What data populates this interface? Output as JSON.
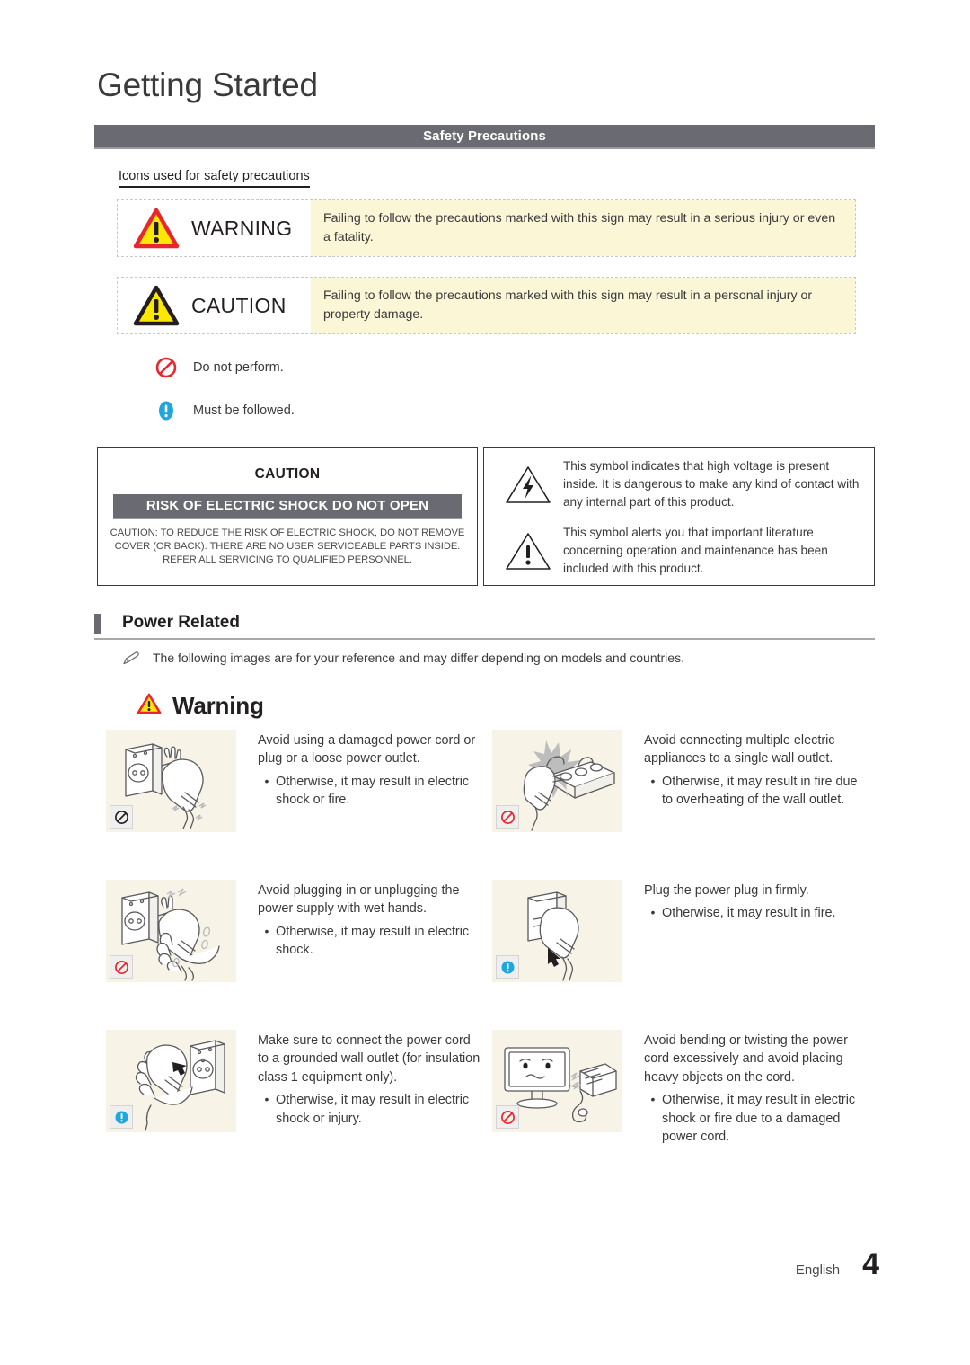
{
  "document": {
    "chapter_title": "Getting Started",
    "section_bar_label": "Safety Precautions",
    "sub_heading": "Icons used for safety precautions"
  },
  "definitions": [
    {
      "icon": "warning-triangle-red-icon",
      "word": "WARNING",
      "text": "Failing to follow the precautions marked with this sign may result in a serious injury or even a fatality."
    },
    {
      "icon": "caution-triangle-black-icon",
      "word": "CAUTION",
      "text": "Failing to follow the precautions marked with this sign may result in a personal injury or property damage."
    }
  ],
  "legend": [
    {
      "icon": "prohibited-circle-icon",
      "label": "Do not perform."
    },
    {
      "icon": "mandatory-exclamation-icon",
      "label": "Must be followed."
    }
  ],
  "shock_box": {
    "caution_title": "CAUTION",
    "bar_label": "RISK OF ELECTRIC SHOCK DO NOT OPEN",
    "body_line_1": "CAUTION: TO REDUCE THE RISK OF ELECTRIC SHOCK, DO NOT REMOVE",
    "body_line_2": "COVER (OR BACK). THERE ARE NO USER SERVICEABLE PARTS INSIDE.",
    "body_line_3": "REFER ALL SERVICING TO QUALIFIED PERSONNEL."
  },
  "symbol_box": {
    "rows": [
      {
        "icon": "high-voltage-lightning-triangle-icon",
        "text": "This symbol indicates that high voltage is present inside. It is dangerous to make any kind of contact with any internal part of this product."
      },
      {
        "icon": "attention-exclamation-triangle-icon",
        "text": "This symbol alerts you that important literature concerning operation and maintenance has been included with this product."
      }
    ]
  },
  "topic": {
    "title": "Power Related",
    "note_icon": "pencil-note-icon",
    "note": "The following images are for your reference and may differ depending on models and countries.",
    "warning_heading_icon": "warning-triangle-small-icon",
    "warning_heading": "Warning"
  },
  "precautions": [
    {
      "illustration": "damaged-plug-outlet-illustration",
      "badge": "prohibited-badge-icon",
      "main": "Avoid using a damaged power cord or plug or a loose power outlet.",
      "bullet": "•",
      "sub": "Otherwise, it may result in electric shock or fire."
    },
    {
      "illustration": "multi-outlet-strip-illustration",
      "badge": "prohibited-badge-icon",
      "main": "Avoid connecting multiple electric appliances to a single wall outlet.",
      "bullet": "•",
      "sub": "Otherwise, it may result in fire due to overheating of the wall outlet."
    },
    {
      "illustration": "wet-hands-plug-illustration",
      "badge": "prohibited-badge-icon",
      "main": "Avoid plugging in or unplugging the power supply with wet hands.",
      "bullet": "•",
      "sub": "Otherwise, it may result in electric shock."
    },
    {
      "illustration": "plug-in-firmly-illustration",
      "badge": "mandatory-badge-icon",
      "main": "Plug the power plug in firmly.",
      "bullet": "•",
      "sub": "Otherwise, it may result in fire."
    },
    {
      "illustration": "grounded-outlet-illustration",
      "badge": "mandatory-badge-icon",
      "main": "Make sure to connect the power cord to a grounded wall outlet (for insulation class 1 equipment only).",
      "bullet": "•",
      "sub": "Otherwise, it may result in electric shock or injury."
    },
    {
      "illustration": "bent-cord-monitor-illustration",
      "badge": "prohibited-badge-icon",
      "main": "Avoid bending or twisting the power cord excessively and avoid placing heavy objects on the cord.",
      "bullet": "•",
      "sub": "Otherwise, it may result in electric shock or fire due to a damaged power cord."
    }
  ],
  "footer": {
    "language": "English",
    "page_number": "4"
  },
  "colors": {
    "gray_bar": "#6a6a72",
    "yellow_panel": "#fbf6d6",
    "illustration_bg": "#f7f3e6",
    "warning_red": "#e8262b",
    "warning_yellow": "#ffe800",
    "mandatory_blue": "#1fa6dd"
  }
}
